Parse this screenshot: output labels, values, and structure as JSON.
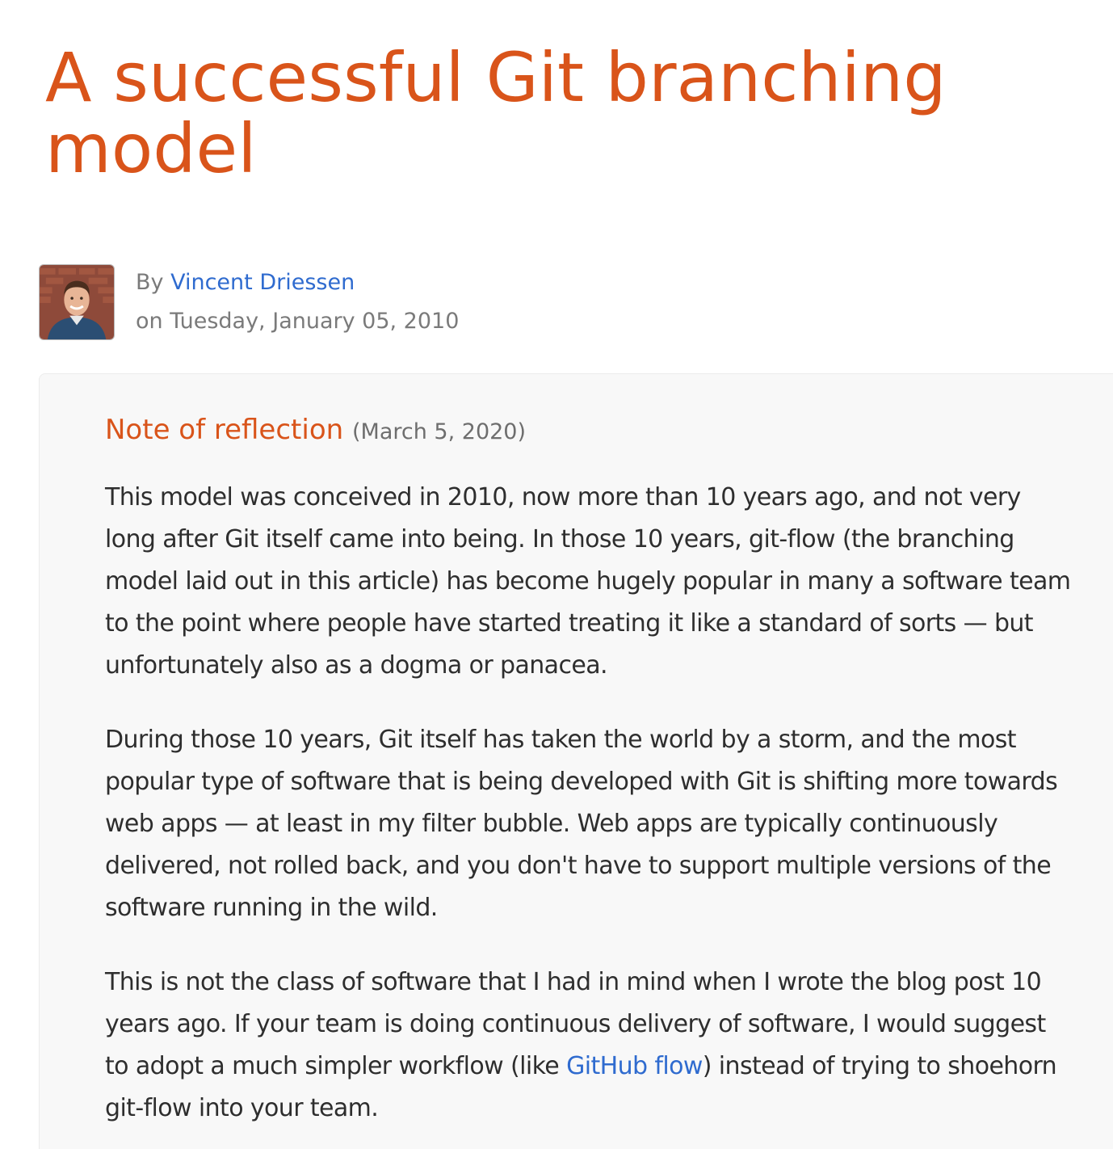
{
  "article": {
    "title": "A successful Git branching model"
  },
  "byline": {
    "by_prefix": "By ",
    "author": "Vincent Driessen",
    "date_line": "on Tuesday, January 05, 2010",
    "avatar_icon": "author-avatar"
  },
  "note": {
    "heading": "Note of reflection",
    "date": "(March 5, 2020)",
    "paragraph1": "This model was conceived in 2010, now more than 10 years ago, and not very long after Git itself came into being. In those 10 years, git-flow (the branching model laid out in this article) has become hugely popular in many a software team to the point where people have started treating it like a standard of sorts — but unfortunately also as a dogma or panacea.",
    "paragraph2": "During those 10 years, Git itself has taken the world by a storm, and the most popular type of software that is being developed with Git is shifting more towards web apps — at least in my filter bubble. Web apps are typically continuously delivered, not rolled back, and you don't have to support multiple versions of the software running in the wild.",
    "paragraph3_before_link": "This is not the class of software that I had in mind when I wrote the blog post 10 years ago. If your team is doing continuous delivery of software, I would suggest to adopt a much simpler workflow (like ",
    "paragraph3_link": "GitHub flow",
    "paragraph3_after_link": ") instead of trying to shoehorn git-flow into your team."
  },
  "colors": {
    "accent_orange": "#d9541a",
    "link_blue": "#2f6bcf",
    "meta_gray": "#7a7a7a",
    "note_bg": "#f8f8f8"
  }
}
